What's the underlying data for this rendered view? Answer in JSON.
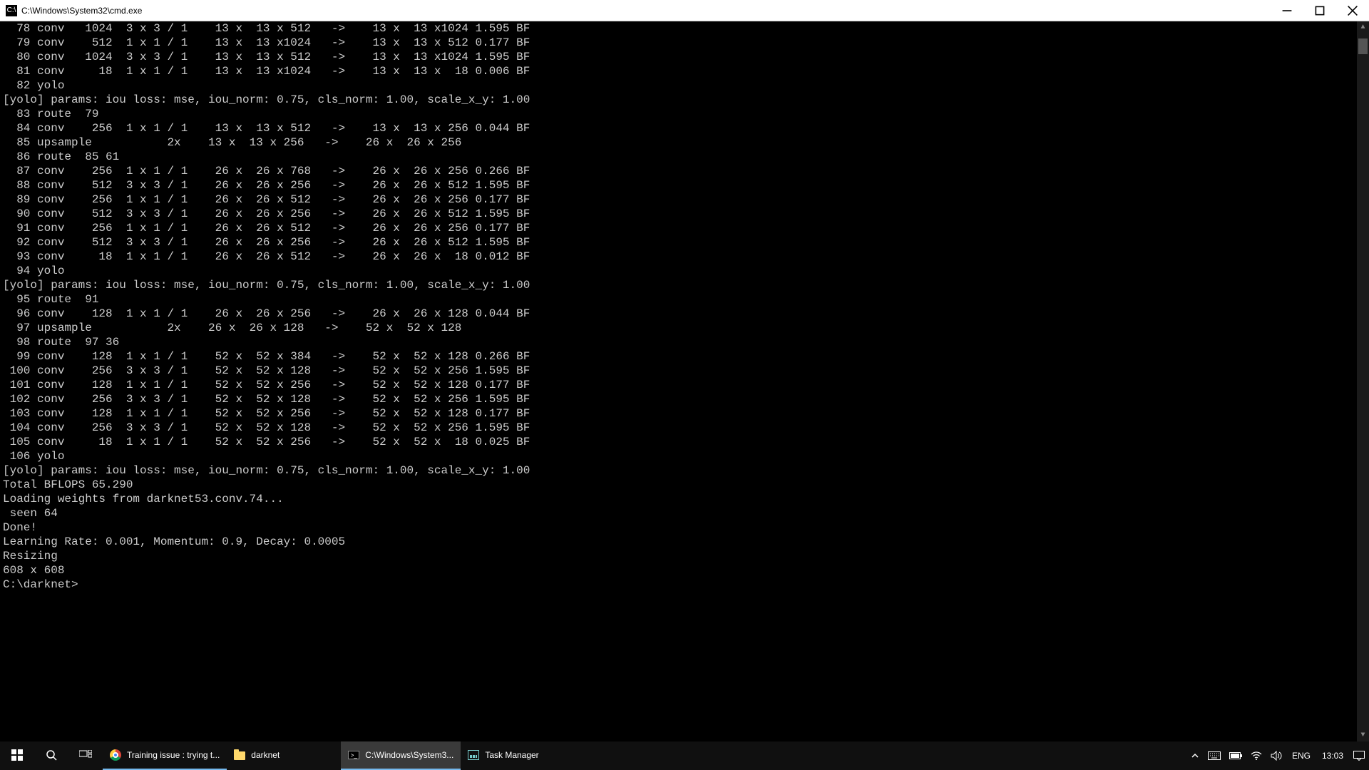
{
  "window": {
    "title": "C:\\Windows\\System32\\cmd.exe",
    "icon_label": "C:\\"
  },
  "terminal": {
    "lines": [
      "  78 conv   1024  3 x 3 / 1    13 x  13 x 512   ->    13 x  13 x1024 1.595 BF",
      "  79 conv    512  1 x 1 / 1    13 x  13 x1024   ->    13 x  13 x 512 0.177 BF",
      "  80 conv   1024  3 x 3 / 1    13 x  13 x 512   ->    13 x  13 x1024 1.595 BF",
      "  81 conv     18  1 x 1 / 1    13 x  13 x1024   ->    13 x  13 x  18 0.006 BF",
      "  82 yolo",
      "[yolo] params: iou loss: mse, iou_norm: 0.75, cls_norm: 1.00, scale_x_y: 1.00",
      "  83 route  79",
      "  84 conv    256  1 x 1 / 1    13 x  13 x 512   ->    13 x  13 x 256 0.044 BF",
      "  85 upsample           2x    13 x  13 x 256   ->    26 x  26 x 256",
      "  86 route  85 61",
      "  87 conv    256  1 x 1 / 1    26 x  26 x 768   ->    26 x  26 x 256 0.266 BF",
      "  88 conv    512  3 x 3 / 1    26 x  26 x 256   ->    26 x  26 x 512 1.595 BF",
      "  89 conv    256  1 x 1 / 1    26 x  26 x 512   ->    26 x  26 x 256 0.177 BF",
      "  90 conv    512  3 x 3 / 1    26 x  26 x 256   ->    26 x  26 x 512 1.595 BF",
      "  91 conv    256  1 x 1 / 1    26 x  26 x 512   ->    26 x  26 x 256 0.177 BF",
      "  92 conv    512  3 x 3 / 1    26 x  26 x 256   ->    26 x  26 x 512 1.595 BF",
      "  93 conv     18  1 x 1 / 1    26 x  26 x 512   ->    26 x  26 x  18 0.012 BF",
      "  94 yolo",
      "[yolo] params: iou loss: mse, iou_norm: 0.75, cls_norm: 1.00, scale_x_y: 1.00",
      "  95 route  91",
      "  96 conv    128  1 x 1 / 1    26 x  26 x 256   ->    26 x  26 x 128 0.044 BF",
      "  97 upsample           2x    26 x  26 x 128   ->    52 x  52 x 128",
      "  98 route  97 36",
      "  99 conv    128  1 x 1 / 1    52 x  52 x 384   ->    52 x  52 x 128 0.266 BF",
      " 100 conv    256  3 x 3 / 1    52 x  52 x 128   ->    52 x  52 x 256 1.595 BF",
      " 101 conv    128  1 x 1 / 1    52 x  52 x 256   ->    52 x  52 x 128 0.177 BF",
      " 102 conv    256  3 x 3 / 1    52 x  52 x 128   ->    52 x  52 x 256 1.595 BF",
      " 103 conv    128  1 x 1 / 1    52 x  52 x 256   ->    52 x  52 x 128 0.177 BF",
      " 104 conv    256  3 x 3 / 1    52 x  52 x 128   ->    52 x  52 x 256 1.595 BF",
      " 105 conv     18  1 x 1 / 1    52 x  52 x 256   ->    52 x  52 x  18 0.025 BF",
      " 106 yolo",
      "[yolo] params: iou loss: mse, iou_norm: 0.75, cls_norm: 1.00, scale_x_y: 1.00",
      "Total BFLOPS 65.290",
      "Loading weights from darknet53.conv.74...",
      " seen 64",
      "Done!",
      "Learning Rate: 0.001, Momentum: 0.9, Decay: 0.0005",
      "Resizing",
      "608 x 608",
      "",
      "C:\\darknet>"
    ]
  },
  "taskbar": {
    "tasks": [
      {
        "id": "chrome",
        "label": "Training issue : trying t...",
        "running": true,
        "active": false
      },
      {
        "id": "explorer",
        "label": "darknet",
        "running": false,
        "active": false
      },
      {
        "id": "cmd",
        "label": "C:\\Windows\\System3...",
        "running": true,
        "active": true
      },
      {
        "id": "taskmgr",
        "label": "Task Manager",
        "running": false,
        "active": false
      }
    ],
    "language": "ENG",
    "clock": "13:03"
  }
}
